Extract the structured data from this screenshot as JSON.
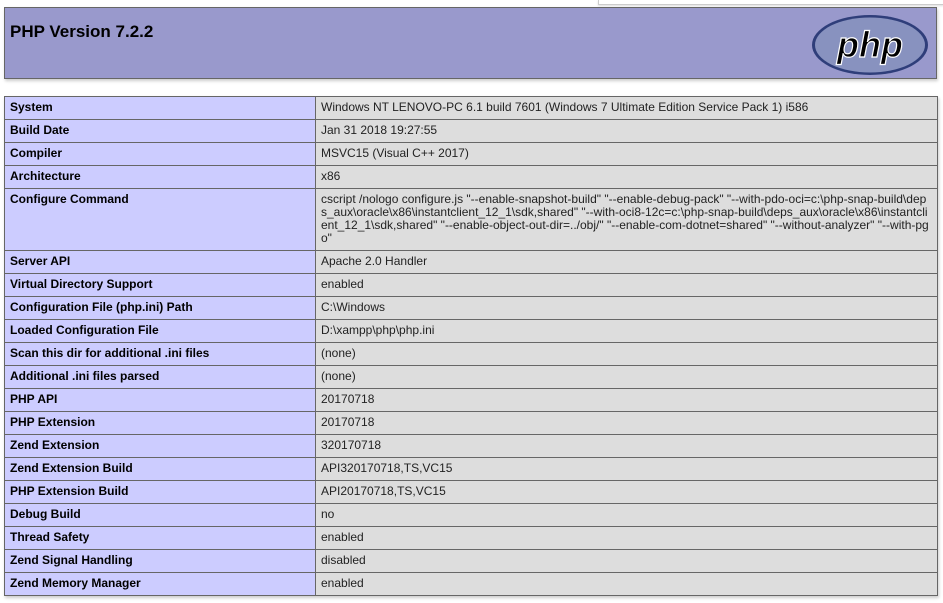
{
  "header": {
    "title": "PHP Version 7.2.2",
    "logo_text": "php",
    "logo_color": "#2f3e7a",
    "logo_bg": "#8892bf",
    "header_bg": "#9999cc"
  },
  "table": {
    "rows": [
      {
        "key": "System",
        "value": "Windows NT LENOVO-PC 6.1 build 7601 (Windows 7 Ultimate Edition Service Pack 1) i586"
      },
      {
        "key": "Build Date",
        "value": "Jan 31 2018 19:27:55"
      },
      {
        "key": "Compiler",
        "value": "MSVC15 (Visual C++ 2017)"
      },
      {
        "key": "Architecture",
        "value": "x86"
      },
      {
        "key": "Configure Command",
        "value": "cscript /nologo configure.js \"--enable-snapshot-build\" \"--enable-debug-pack\" \"--with-pdo-oci=c:\\php-snap-build\\deps_aux\\oracle\\x86\\instantclient_12_1\\sdk,shared\" \"--with-oci8-12c=c:\\php-snap-build\\deps_aux\\oracle\\x86\\instantclient_12_1\\sdk,shared\" \"--enable-object-out-dir=../obj/\" \"--enable-com-dotnet=shared\" \"--without-analyzer\" \"--with-pgo\""
      },
      {
        "key": "Server API",
        "value": "Apache 2.0 Handler"
      },
      {
        "key": "Virtual Directory Support",
        "value": "enabled"
      },
      {
        "key": "Configuration File (php.ini) Path",
        "value": "C:\\Windows"
      },
      {
        "key": "Loaded Configuration File",
        "value": "D:\\xampp\\php\\php.ini"
      },
      {
        "key": "Scan this dir for additional .ini files",
        "value": "(none)"
      },
      {
        "key": "Additional .ini files parsed",
        "value": "(none)"
      },
      {
        "key": "PHP API",
        "value": "20170718"
      },
      {
        "key": "PHP Extension",
        "value": "20170718"
      },
      {
        "key": "Zend Extension",
        "value": "320170718"
      },
      {
        "key": "Zend Extension Build",
        "value": "API320170718,TS,VC15"
      },
      {
        "key": "PHP Extension Build",
        "value": "API20170718,TS,VC15"
      },
      {
        "key": "Debug Build",
        "value": "no"
      },
      {
        "key": "Thread Safety",
        "value": "enabled"
      },
      {
        "key": "Zend Signal Handling",
        "value": "disabled"
      },
      {
        "key": "Zend Memory Manager",
        "value": "enabled"
      }
    ]
  }
}
